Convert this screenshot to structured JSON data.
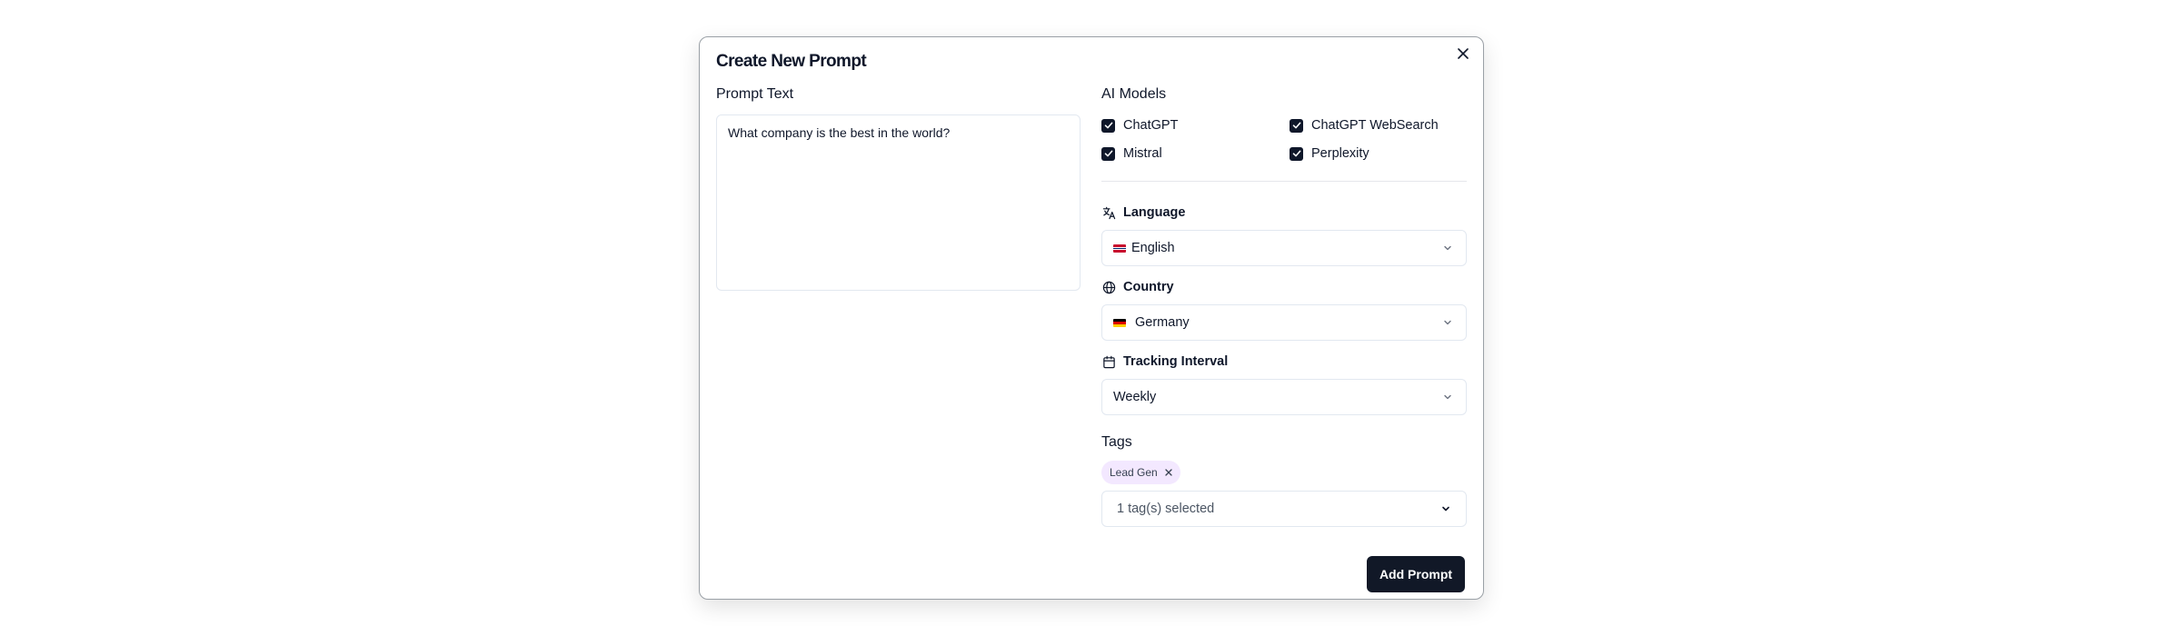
{
  "dialog": {
    "title": "Create New Prompt",
    "close_icon": "close-icon"
  },
  "prompt": {
    "label": "Prompt Text",
    "value": "What company is the best in the world?"
  },
  "models": {
    "label": "AI Models",
    "items": [
      {
        "label": "ChatGPT",
        "checked": true
      },
      {
        "label": "ChatGPT WebSearch",
        "checked": true
      },
      {
        "label": "Mistral",
        "checked": true
      },
      {
        "label": "Perplexity",
        "checked": true
      }
    ]
  },
  "language": {
    "label": "Language",
    "icon": "translate-icon",
    "value": "English",
    "flag": "uk-flag-icon"
  },
  "country": {
    "label": "Country",
    "icon": "globe-icon",
    "value": "Germany",
    "flag": "germany-flag-icon"
  },
  "interval": {
    "label": "Tracking Interval",
    "icon": "calendar-icon",
    "value": "Weekly"
  },
  "tags": {
    "label": "Tags",
    "chips": [
      "Lead Gen"
    ],
    "summary": "1 tag(s) selected"
  },
  "actions": {
    "add_label": "Add Prompt"
  },
  "colors": {
    "primary": "#111827",
    "tag_bg": "#f3e8ff",
    "border": "#e2e8f0"
  }
}
